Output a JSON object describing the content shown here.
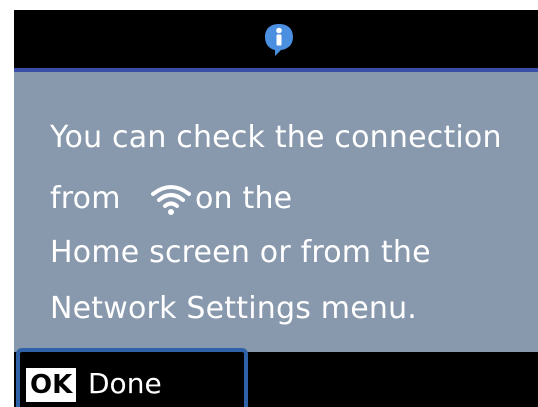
{
  "header": {
    "icon": "info-bubble-icon"
  },
  "message": {
    "line1": "You can check the connection",
    "line2_prefix": "from",
    "line2_icon": "wifi-icon",
    "line2_suffix": "on the",
    "line3": "Home screen or from the",
    "line4": "Network Settings menu."
  },
  "footer": {
    "ok_key": "OK",
    "done_label": "Done"
  },
  "colors": {
    "panel_bg": "#8898ad",
    "header_rule": "#3b4fa8",
    "focus_frame": "#2f62a8",
    "text": "#ffffff"
  }
}
